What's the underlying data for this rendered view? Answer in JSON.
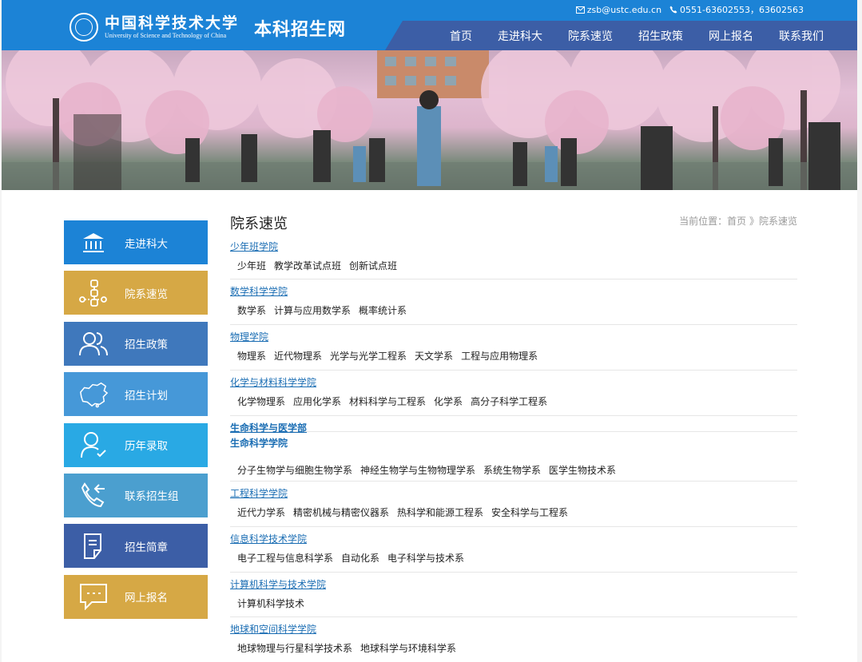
{
  "header": {
    "logo_cn": "中国科学技术大学",
    "logo_en": "University of Science and Technology of China",
    "site_title": "本科招生网",
    "email": "zsb@ustc.edu.cn",
    "phone": "0551-63602553，63602563",
    "nav": [
      "首页",
      "走进科大",
      "院系速览",
      "招生政策",
      "网上报名",
      "联系我们"
    ]
  },
  "sidebar": {
    "items": [
      {
        "label": "走进科大",
        "icon": "building-icon",
        "color": "#1c83d6"
      },
      {
        "label": "院系速览",
        "icon": "network-icon",
        "color": "#d6a845"
      },
      {
        "label": "招生政策",
        "icon": "users-icon",
        "color": "#3f78bc"
      },
      {
        "label": "招生计划",
        "icon": "china-map-icon",
        "color": "#4698d8"
      },
      {
        "label": "历年录取",
        "icon": "user-check-icon",
        "color": "#29a9e4"
      },
      {
        "label": "联系招生组",
        "icon": "phone-icon",
        "color": "#4b9fcf"
      },
      {
        "label": "招生简章",
        "icon": "document-icon",
        "color": "#3c5ea6"
      },
      {
        "label": "网上报名",
        "icon": "chat-icon",
        "color": "#d6a845"
      }
    ]
  },
  "main": {
    "title": "院系速览",
    "breadcrumb": "当前位置：首页 》院系速览",
    "schools": [
      {
        "name": "少年班学院",
        "depts": [
          "少年班",
          "教学改革试点班",
          "创新试点班"
        ]
      },
      {
        "name": "数学科学学院",
        "depts": [
          "数学系",
          "计算与应用数学系",
          "概率统计系"
        ]
      },
      {
        "name": "物理学院",
        "depts": [
          "物理系",
          "近代物理系",
          "光学与光学工程系",
          "天文学系",
          "工程与应用物理系"
        ]
      },
      {
        "name": "化学与材料科学学院",
        "depts": [
          "化学物理系",
          "应用化学系",
          "材料科学与工程系",
          "化学系",
          "高分子科学工程系"
        ]
      },
      {
        "name": "生命科学与医学部",
        "depts": []
      },
      {
        "name": "生命科学学院",
        "depts": [
          "分子生物学与细胞生物学系",
          "神经生物学与生物物理学系",
          "系统生物学系",
          "医学生物技术系"
        ]
      },
      {
        "name": "工程科学学院",
        "depts": [
          "近代力学系",
          "精密机械与精密仪器系",
          "热科学和能源工程系",
          "安全科学与工程系"
        ]
      },
      {
        "name": "信息科学技术学院",
        "depts": [
          "电子工程与信息科学系",
          "自动化系",
          "电子科学与技术系"
        ]
      },
      {
        "name": "计算机科学与技术学院",
        "depts": [
          "计算机科学技术"
        ]
      },
      {
        "name": "地球和空间科学学院",
        "depts": [
          "地球物理与行星科学技术系",
          "地球科学与环境科学系"
        ]
      }
    ]
  }
}
